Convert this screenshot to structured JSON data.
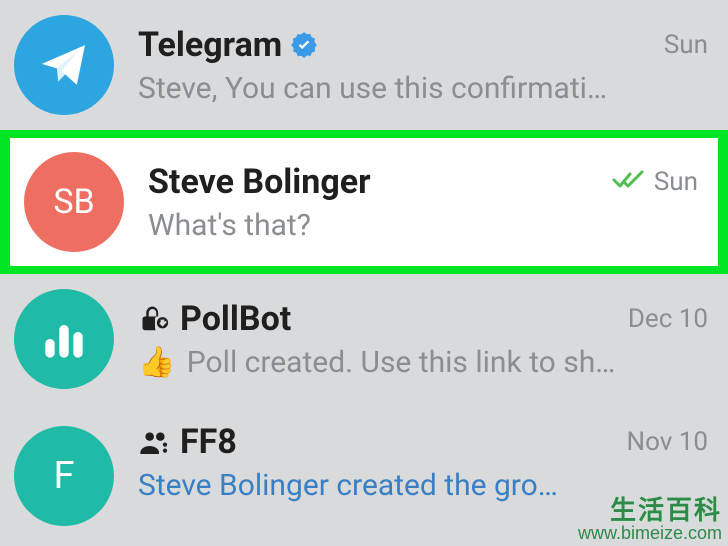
{
  "chats": [
    {
      "id": "telegram",
      "avatar": {
        "type": "telegram"
      },
      "title": "Telegram",
      "verified": true,
      "time": "Sun",
      "read_receipt": false,
      "preview": "Steve,  You can use this confirmati…",
      "preview_link": false,
      "highlighted": false
    },
    {
      "id": "steve-bolinger",
      "avatar": {
        "type": "initials",
        "text": "SB",
        "class": "avatar-sb"
      },
      "title": "Steve Bolinger",
      "verified": false,
      "time": "Sun",
      "read_receipt": true,
      "preview": "What's that?",
      "preview_link": false,
      "highlighted": true
    },
    {
      "id": "pollbot",
      "avatar": {
        "type": "pollbot"
      },
      "prefix_icon": "lock",
      "title": "PollBot",
      "verified": false,
      "time": "Dec 10",
      "read_receipt": false,
      "preview_emoji": "👍",
      "preview": " Poll created. Use this link to sh…",
      "preview_link": false,
      "highlighted": false
    },
    {
      "id": "ff8",
      "avatar": {
        "type": "initials",
        "text": "F",
        "class": "avatar-f"
      },
      "prefix_icon": "group",
      "title": "FF8",
      "verified": false,
      "time": "Nov 10",
      "read_receipt": false,
      "preview": "Steve Bolinger created the gro…",
      "preview_link": true,
      "highlighted": false
    }
  ],
  "watermark": {
    "line1": "生活百科",
    "line2": "www.bimeize.com"
  }
}
